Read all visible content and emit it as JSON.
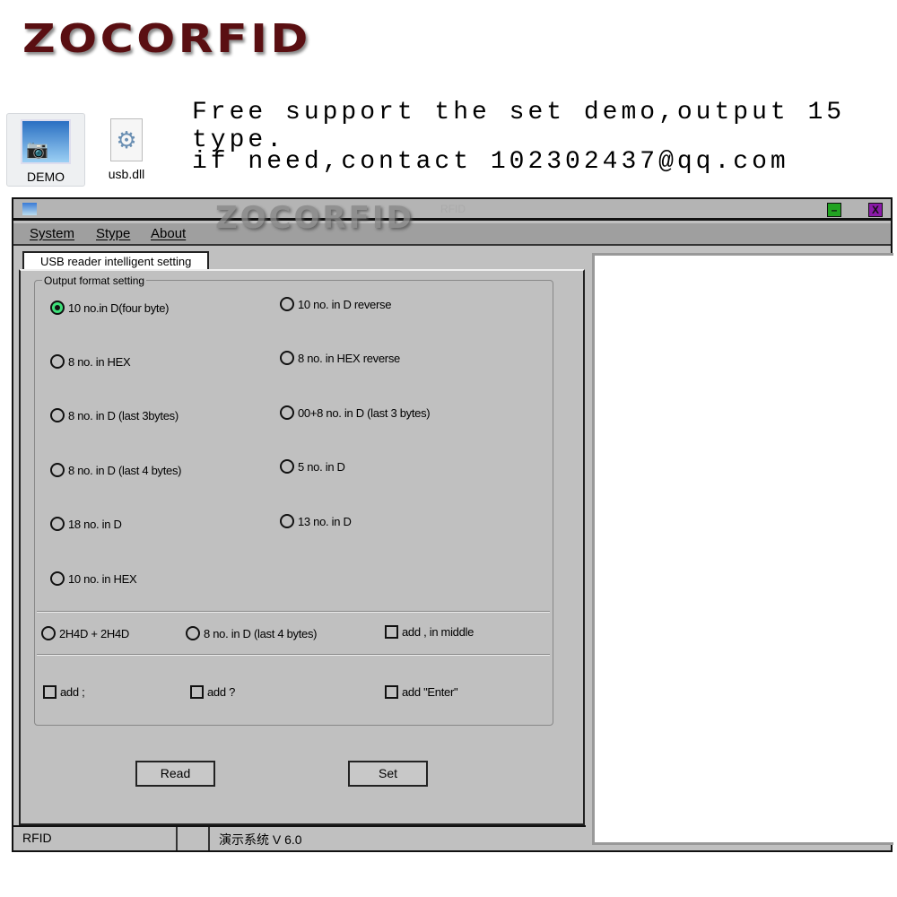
{
  "brand": "ZOCORFID",
  "promo": {
    "line1": "Free support the set demo,output 15 type.",
    "line2": "if need,contact 102302437@qq.com"
  },
  "desktop": [
    {
      "label": "DEMO",
      "icon": "image-camera-icon"
    },
    {
      "label": "usb.dll",
      "icon": "dll-gear-icon"
    }
  ],
  "window": {
    "title": "RFID",
    "watermark": "ZOCORFID",
    "minimize_color": "#22a322",
    "close_color": "#8a1aa8"
  },
  "menu": [
    "System",
    "Stype",
    "About"
  ],
  "tab": "USB reader intelligent setting",
  "group_title": "Output format setting",
  "radios_left": [
    "10 no.in D(four byte)",
    "8 no. in HEX",
    " 8 no. in D (last 3bytes)",
    "8 no. in D (last 4 bytes)",
    "18 no. in D",
    "10 no. in HEX"
  ],
  "radios_right": [
    "10 no. in D reverse",
    "8 no. in HEX reverse",
    " 00+8 no. in D (last 3 bytes)",
    "5 no. in D",
    "13 no. in D"
  ],
  "radios_row2": [
    "2H4D + 2H4D",
    "8 no. in D (last 4 bytes)"
  ],
  "checkbox_middle": "add , in middle",
  "checkboxes": [
    "add ;",
    "add ?",
    "add \"Enter\""
  ],
  "selected": "10 no.in D(four byte)",
  "buttons": {
    "read": "Read",
    "set": "Set"
  },
  "status": {
    "left": "RFID",
    "right": "演示系统  V 6.0"
  }
}
